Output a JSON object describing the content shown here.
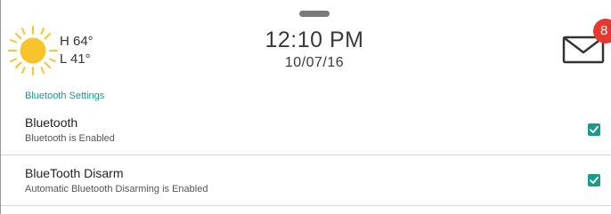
{
  "weather": {
    "high": "H 64°",
    "low": "L 41°",
    "icon": "sun-icon"
  },
  "clock": {
    "time": "12:10 PM",
    "date": "10/07/16"
  },
  "messages": {
    "icon": "mail-icon",
    "badge_count": "8"
  },
  "section": {
    "title": "Bluetooth Settings"
  },
  "settings": [
    {
      "title": "Bluetooth",
      "subtitle": "Bluetooth is Enabled",
      "checked": true
    },
    {
      "title": "BlueTooth Disarm",
      "subtitle": "Automatic Bluetooth Disarming is Enabled",
      "checked": true
    }
  ],
  "colors": {
    "accent": "#1a9b8c",
    "badge": "#e5382e",
    "sun": "#f7c52b"
  }
}
